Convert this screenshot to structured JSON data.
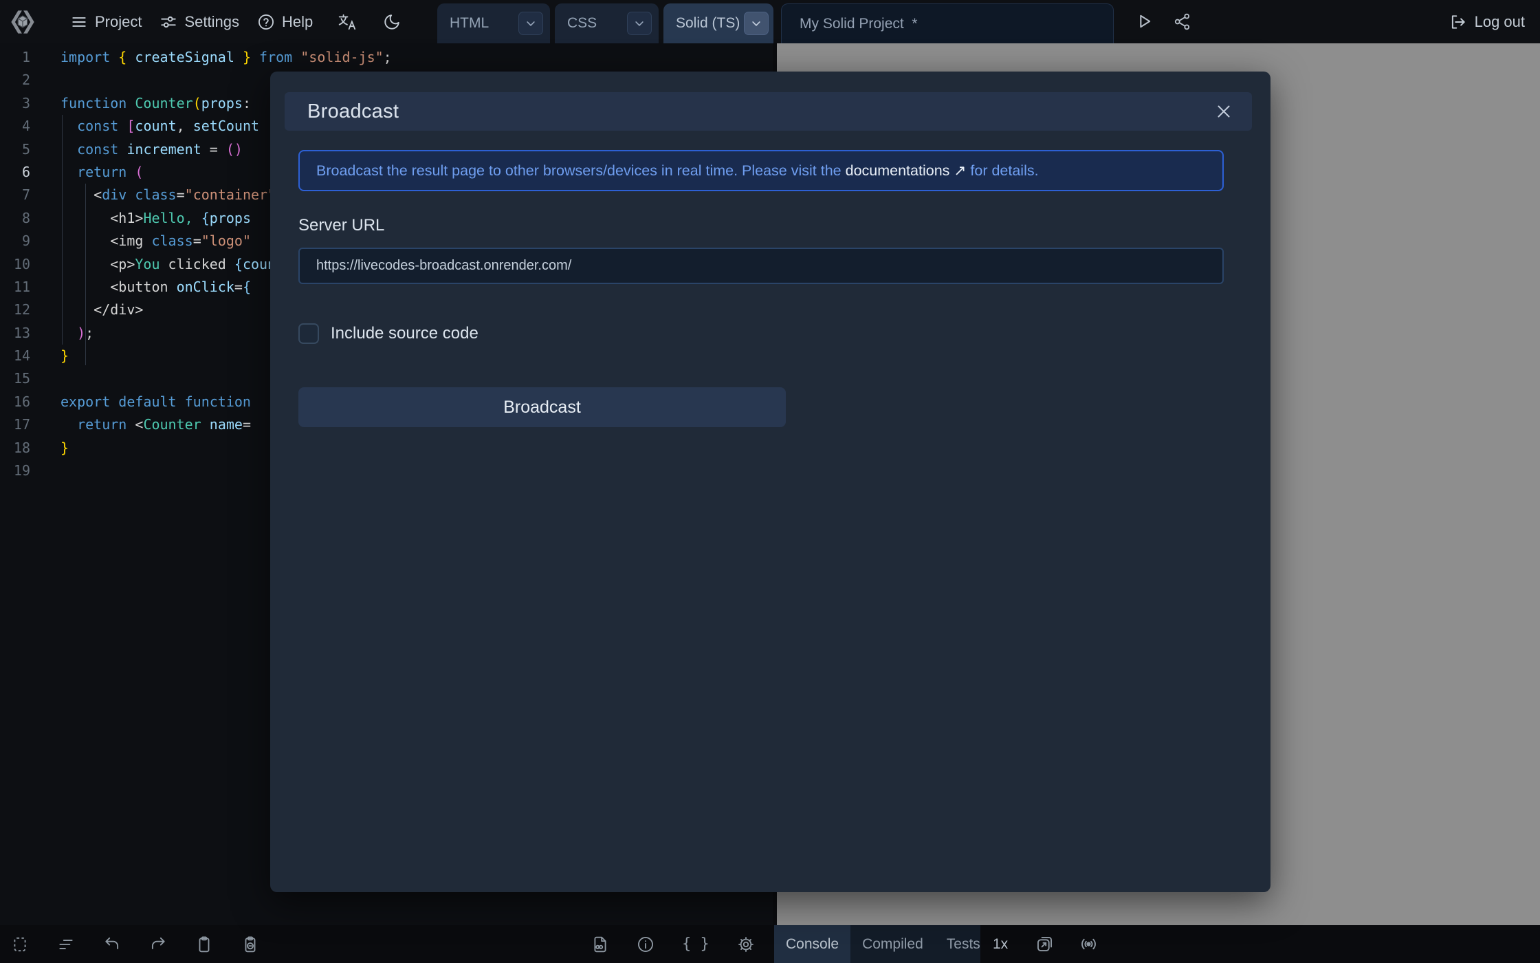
{
  "toolbar": {
    "project_label": "Project",
    "settings_label": "Settings",
    "help_label": "Help",
    "logout_label": "Log out",
    "tabs": [
      {
        "label": "HTML"
      },
      {
        "label": "CSS"
      },
      {
        "label": "Solid (TS)",
        "active": true
      }
    ],
    "project_title": "My Solid Project  *"
  },
  "editor": {
    "active_line": 6,
    "token_colors": {
      "kw": "#569cd6",
      "id": "#9cdcfe",
      "pl": "#d4d4d4",
      "str": "#ce9178",
      "type": "#4ec9b0",
      "b1": "#ffd700",
      "b2": "#da70d6",
      "b3": "#87cefa"
    },
    "lines": [
      {
        "n": 1,
        "segs": [
          [
            "kw",
            "import"
          ],
          [
            "pl",
            " "
          ],
          [
            "b1",
            "{"
          ],
          [
            "pl",
            " "
          ],
          [
            "id",
            "createSignal"
          ],
          [
            "pl",
            " "
          ],
          [
            "b1",
            "}"
          ],
          [
            "pl",
            " "
          ],
          [
            "kw",
            "from"
          ],
          [
            "pl",
            " "
          ],
          [
            "str",
            "\"solid-js\""
          ],
          [
            "pl",
            ";"
          ]
        ]
      },
      {
        "n": 2,
        "segs": []
      },
      {
        "n": 3,
        "segs": [
          [
            "kw",
            "function"
          ],
          [
            "pl",
            " "
          ],
          [
            "type",
            "Counter"
          ],
          [
            "b1",
            "("
          ],
          [
            "id",
            "props"
          ],
          [
            "pl",
            ":"
          ]
        ]
      },
      {
        "n": 4,
        "segs": [
          [
            "pl",
            "  "
          ],
          [
            "kw",
            "const"
          ],
          [
            "pl",
            " "
          ],
          [
            "b2",
            "["
          ],
          [
            "id",
            "count"
          ],
          [
            "pl",
            ", "
          ],
          [
            "id",
            "setCount"
          ]
        ]
      },
      {
        "n": 5,
        "segs": [
          [
            "pl",
            "  "
          ],
          [
            "kw",
            "const"
          ],
          [
            "pl",
            " "
          ],
          [
            "id",
            "increment"
          ],
          [
            "pl",
            " = "
          ],
          [
            "b2",
            "()"
          ]
        ]
      },
      {
        "n": 6,
        "segs": [
          [
            "pl",
            "  "
          ],
          [
            "kw",
            "return"
          ],
          [
            "pl",
            " "
          ],
          [
            "b2",
            "("
          ]
        ]
      },
      {
        "n": 7,
        "segs": [
          [
            "pl",
            "    <"
          ],
          [
            "kw",
            "div"
          ],
          [
            "pl",
            " "
          ],
          [
            "kw",
            "class"
          ],
          [
            "pl",
            "="
          ],
          [
            "str",
            "\"container\""
          ]
        ]
      },
      {
        "n": 8,
        "segs": [
          [
            "pl",
            "      <"
          ],
          [
            "pl",
            "h1"
          ],
          [
            "pl",
            ">"
          ],
          [
            "type",
            "Hello,"
          ],
          [
            "pl",
            " "
          ],
          [
            "b3",
            "{"
          ],
          [
            "id",
            "props"
          ]
        ]
      },
      {
        "n": 9,
        "segs": [
          [
            "pl",
            "      <"
          ],
          [
            "pl",
            "img"
          ],
          [
            "pl",
            " "
          ],
          [
            "kw",
            "class"
          ],
          [
            "pl",
            "="
          ],
          [
            "str",
            "\"logo\""
          ]
        ]
      },
      {
        "n": 10,
        "segs": [
          [
            "pl",
            "      <"
          ],
          [
            "pl",
            "p"
          ],
          [
            "pl",
            ">"
          ],
          [
            "type",
            "You"
          ],
          [
            "pl",
            " clicked "
          ],
          [
            "b3",
            "{"
          ],
          [
            "id",
            "count"
          ]
        ]
      },
      {
        "n": 11,
        "segs": [
          [
            "pl",
            "      <"
          ],
          [
            "pl",
            "button"
          ],
          [
            "pl",
            " "
          ],
          [
            "id",
            "onClick"
          ],
          [
            "pl",
            "="
          ],
          [
            "b3",
            "{"
          ]
        ]
      },
      {
        "n": 12,
        "segs": [
          [
            "pl",
            "    </"
          ],
          [
            "pl",
            "div"
          ],
          [
            "pl",
            ">"
          ]
        ]
      },
      {
        "n": 13,
        "segs": [
          [
            "pl",
            "  "
          ],
          [
            "b2",
            ")"
          ],
          [
            "pl",
            ";"
          ]
        ]
      },
      {
        "n": 14,
        "segs": [
          [
            "b1",
            "}"
          ]
        ]
      },
      {
        "n": 15,
        "segs": []
      },
      {
        "n": 16,
        "segs": [
          [
            "kw",
            "export"
          ],
          [
            "pl",
            " "
          ],
          [
            "kw",
            "default"
          ],
          [
            "pl",
            " "
          ],
          [
            "kw",
            "function"
          ]
        ]
      },
      {
        "n": 17,
        "segs": [
          [
            "pl",
            "  "
          ],
          [
            "kw",
            "return"
          ],
          [
            "pl",
            " <"
          ],
          [
            "type",
            "Counter"
          ],
          [
            "pl",
            " "
          ],
          [
            "id",
            "name"
          ],
          [
            "pl",
            "="
          ]
        ]
      },
      {
        "n": 18,
        "segs": [
          [
            "b1",
            "}"
          ]
        ]
      },
      {
        "n": 19,
        "segs": []
      }
    ]
  },
  "modal": {
    "title": "Broadcast",
    "info_text_before": "Broadcast the result page to other browsers/devices in real time. Please visit the ",
    "info_link": "documentations",
    "info_link_arrow": "↗",
    "info_text_after": " for details.",
    "server_url_label": "Server URL",
    "server_url_value": "https://livecodes-broadcast.onrender.com/",
    "include_source_label": "Include source code",
    "submit_label": "Broadcast"
  },
  "statusbar": {
    "console_label": "Console",
    "compiled_label": "Compiled",
    "tests_label": "Tests",
    "zoom_label": "1x"
  },
  "colors": {
    "accent_blue": "#2d60d4",
    "info_text": "#6f9ef0",
    "modal_bg": "#202a38",
    "modal_header_bg": "#26334a",
    "result_bg": "#8e8e8e",
    "editor_bg": "#0d0f13"
  }
}
